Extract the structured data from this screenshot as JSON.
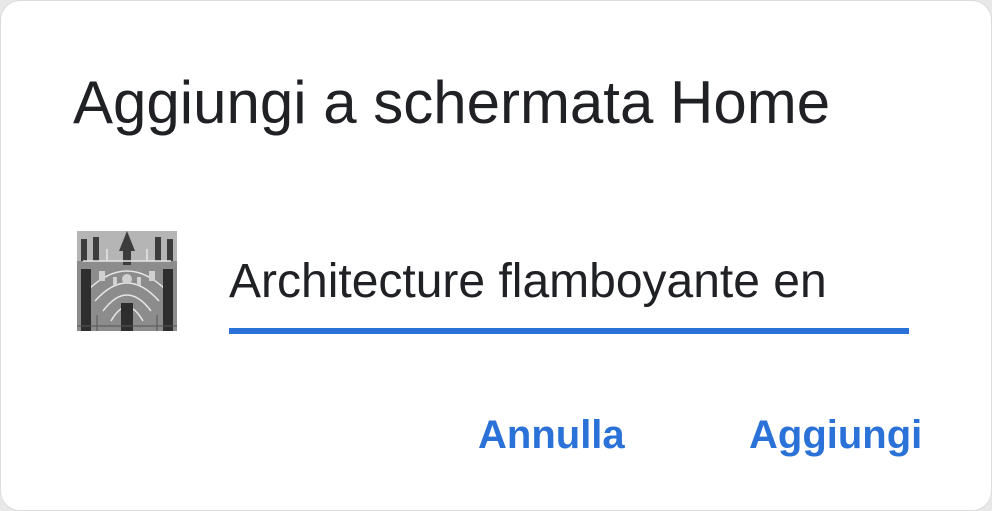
{
  "dialog": {
    "title": "Aggiungi a schermata Home",
    "shortcut_name": "Architecture flamboyante en",
    "thumbnail_icon": "gothic-facade-thumbnail",
    "accent_color": "#2a71d8",
    "buttons": {
      "cancel_label": "Annulla",
      "add_label": "Aggiungi"
    }
  }
}
